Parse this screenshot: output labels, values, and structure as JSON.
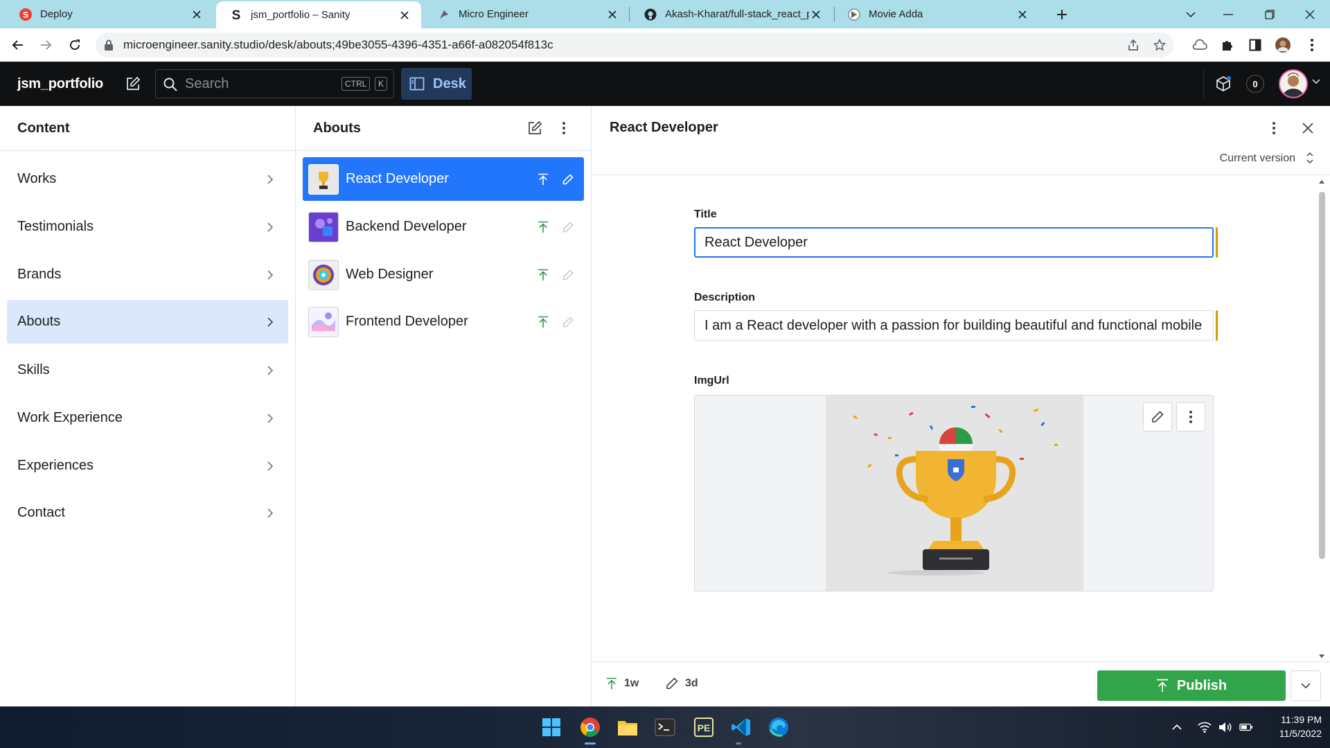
{
  "browser": {
    "tabs": [
      {
        "title": "Deploy"
      },
      {
        "title": "jsm_portfolio – Sanity"
      },
      {
        "title": "Micro Engineer"
      },
      {
        "title": "Akash-Kharat/full-stack_react_po"
      },
      {
        "title": "Movie Adda"
      }
    ],
    "url": "microengineer.sanity.studio/desk/abouts;49be3055-4396-4351-a66f-a082054f813c"
  },
  "navbar": {
    "brand": "jsm_portfolio",
    "search_placeholder": "Search",
    "kbd_ctrl": "CTRL",
    "kbd_k": "K",
    "desk_label": "Desk",
    "notification_count": "0"
  },
  "content_pane": {
    "title": "Content",
    "items": [
      {
        "label": "Works"
      },
      {
        "label": "Testimonials"
      },
      {
        "label": "Brands"
      },
      {
        "label": "Abouts"
      },
      {
        "label": "Skills"
      },
      {
        "label": "Work Experience"
      },
      {
        "label": "Experiences"
      },
      {
        "label": "Contact"
      }
    ]
  },
  "abouts_pane": {
    "title": "Abouts",
    "items": [
      {
        "label": "React Developer"
      },
      {
        "label": "Backend Developer"
      },
      {
        "label": "Web Designer"
      },
      {
        "label": "Frontend Developer"
      }
    ]
  },
  "document": {
    "title": "React Developer",
    "version_label": "Current version",
    "fields": {
      "title_label": "Title",
      "title_value": "React Developer",
      "description_label": "Description",
      "description_value": "I am a React developer with a passion for building beautiful and functional mobile",
      "imgurl_label": "ImgUrl"
    },
    "footer": {
      "published_ago": "1w",
      "edited_ago": "3d",
      "publish_label": "Publish"
    }
  },
  "taskbar": {
    "time": "11:39 PM",
    "date": "11/5/2022"
  },
  "colors": {
    "accent": "#2276fc",
    "selected_nav": "#dbe7fb",
    "publish_green": "#32a449",
    "change_indicator": "#d69a07"
  }
}
